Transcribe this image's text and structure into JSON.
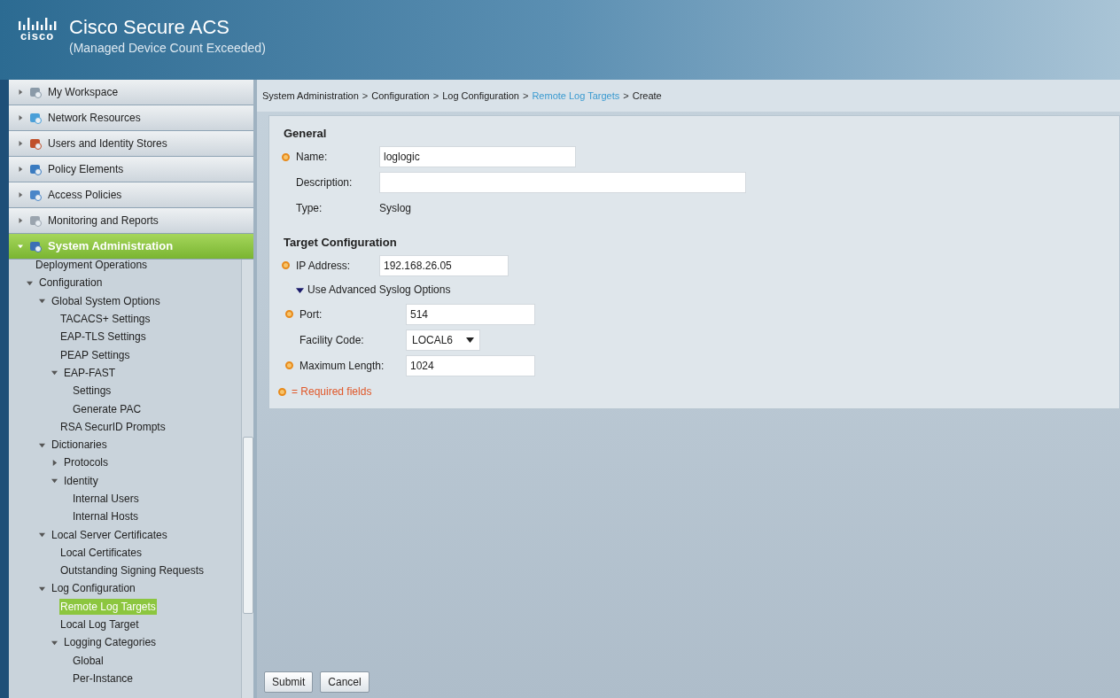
{
  "header": {
    "logo_text": "cisco",
    "title": "Cisco Secure ACS",
    "subtitle": "(Managed Device Count Exceeded)"
  },
  "nav": [
    {
      "label": "My Workspace",
      "selected": false,
      "kind": "workspace"
    },
    {
      "label": "Network Resources",
      "selected": false,
      "kind": "network"
    },
    {
      "label": "Users and Identity Stores",
      "selected": false,
      "kind": "users"
    },
    {
      "label": "Policy Elements",
      "selected": false,
      "kind": "policy"
    },
    {
      "label": "Access Policies",
      "selected": false,
      "kind": "access"
    },
    {
      "label": "Monitoring and Reports",
      "selected": false,
      "kind": "monitor"
    },
    {
      "label": "System Administration",
      "selected": true,
      "kind": "admin"
    }
  ],
  "tree": [
    {
      "label": "Deployment Operations",
      "selected": false
    },
    {
      "label": "Configuration",
      "expanded": true,
      "children": [
        {
          "label": "Global System Options",
          "expanded": true,
          "children": [
            {
              "label": "TACACS+ Settings",
              "selected": false
            },
            {
              "label": "EAP-TLS Settings",
              "selected": false
            },
            {
              "label": "PEAP Settings",
              "selected": false
            },
            {
              "label": "EAP-FAST",
              "expanded": true,
              "children": [
                {
                  "label": "Settings",
                  "selected": false
                },
                {
                  "label": "Generate PAC",
                  "selected": false
                }
              ]
            },
            {
              "label": "RSA SecurID Prompts",
              "selected": false
            }
          ]
        },
        {
          "label": "Dictionaries",
          "expanded": true,
          "children": [
            {
              "label": "Protocols",
              "expanded": false
            },
            {
              "label": "Identity",
              "expanded": true,
              "children": [
                {
                  "label": "Internal Users",
                  "selected": false
                },
                {
                  "label": "Internal Hosts",
                  "selected": false
                }
              ]
            }
          ]
        },
        {
          "label": "Local Server Certificates",
          "expanded": true,
          "children": [
            {
              "label": "Local Certificates",
              "selected": false
            },
            {
              "label": "Outstanding Signing Requests",
              "selected": false
            }
          ]
        },
        {
          "label": "Log Configuration",
          "expanded": true,
          "children": [
            {
              "label": "Remote Log Targets",
              "selected": true
            },
            {
              "label": "Local Log Target",
              "selected": false
            },
            {
              "label": "Logging Categories",
              "expanded": true,
              "children": [
                {
                  "label": "Global",
                  "selected": false
                },
                {
                  "label": "Per-Instance",
                  "selected": false
                }
              ]
            }
          ]
        }
      ]
    }
  ],
  "breadcrumb": [
    {
      "label": "System Administration",
      "separator": ">",
      "link": false
    },
    {
      "label": "Configuration",
      "separator": ">",
      "link": false
    },
    {
      "label": "Log Configuration",
      "separator": ">",
      "link": false
    },
    {
      "label": "Remote Log Targets",
      "separator": ">",
      "link": true
    },
    {
      "label": "Create",
      "link": false
    }
  ],
  "sections": [
    {
      "title": "General",
      "rows": [
        {
          "kind": "field",
          "label": "Name:",
          "value": "loglogic",
          "required": true
        },
        {
          "kind": "widefield",
          "label": "Description:",
          "required": false
        },
        {
          "kind": "text",
          "label": "Type:",
          "value": "Syslog",
          "required": false
        }
      ]
    },
    {
      "title": "Target Configuration",
      "rows": [
        {
          "kind": "shortfield",
          "label": "IP Address:",
          "value": "192.168.26.05",
          "required": true
        },
        {
          "kind": "toggle",
          "label": "Use Advanced Syslog Options",
          "expanded": true,
          "children": [
            {
              "kind": "shortfield",
              "label": "Port:",
              "value": "514",
              "required": true
            },
            {
              "kind": "select",
              "label": "Facility Code:",
              "value": "LOCAL6",
              "required": false
            },
            {
              "kind": "shortfield",
              "label": "Maximum Length:",
              "value": "1024",
              "required": true
            }
          ]
        }
      ]
    }
  ],
  "required_note": "= Required fields",
  "buttons": [
    "Submit",
    "Cancel"
  ]
}
